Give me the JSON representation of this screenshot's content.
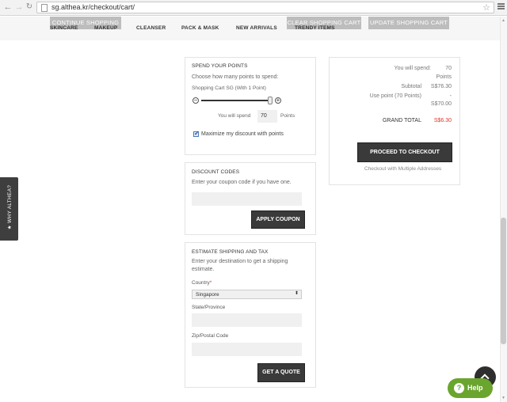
{
  "browser": {
    "back_icon": "←",
    "forward_icon": "→",
    "reload_icon": "↻",
    "url": "sg.althea.kr/checkout/cart/",
    "star_icon": "☆"
  },
  "header": {
    "continue_shopping": "CONTINUE SHOPPING",
    "clear_cart": "CLEAR SHOPPING CART",
    "update_cart": "UPDATE SHOPPING CART",
    "nav": [
      "SKINCARE",
      "MAKEUP",
      "CLEANSER",
      "PACK & MASK",
      "NEW ARRIVALS",
      "TRENDY ITEMS"
    ]
  },
  "points": {
    "title": "SPEND YOUR POINTS",
    "prompt": "Choose how many points to spend:",
    "rule": "Shopping Cart SG (With 1 Point)",
    "minus": "−",
    "plus": "+",
    "spend_label": "You will spend",
    "spend_value": "70",
    "points_label": "Points",
    "maximize_label": "Maximize my discount with points",
    "slider_fraction": 0.97
  },
  "discount": {
    "title": "DISCOUNT CODES",
    "prompt": "Enter your coupon code if you have one.",
    "apply_label": "APPLY COUPON"
  },
  "shipping": {
    "title": "ESTIMATE SHIPPING AND TAX",
    "prompt_line1": "Enter your destination to get a shipping",
    "prompt_line2": "estimate.",
    "country_label": "Country",
    "required_mark": "*",
    "country_value": "Singapore",
    "select_arrow": "⬍",
    "state_label": "State/Province",
    "zip_label": "Zip/Postal Code",
    "quote_label": "GET A QUOTE"
  },
  "summary": {
    "spend_label": "You will spend:",
    "spend_value": "70",
    "spend_unit": "Points",
    "subtotal_label": "Subtotal",
    "subtotal_value": "S$76.30",
    "usepoint_label": "Use point (70 Points)",
    "usepoint_dash": "-",
    "usepoint_value": "S$70.00",
    "grand_total_label": "GRAND TOTAL",
    "grand_total_value": "S$6.30",
    "checkout_label": "PROCEED TO CHECKOUT",
    "multi_address_label": "Checkout with Multiple Addresses"
  },
  "sidetab": {
    "label": "★ WHY ALTHEA?"
  },
  "help": {
    "q": "?",
    "label": "Help"
  },
  "colors": {
    "accent_red": "#e0342b",
    "help_green": "#6aa52e",
    "dark_button": "#3a3a3a"
  }
}
